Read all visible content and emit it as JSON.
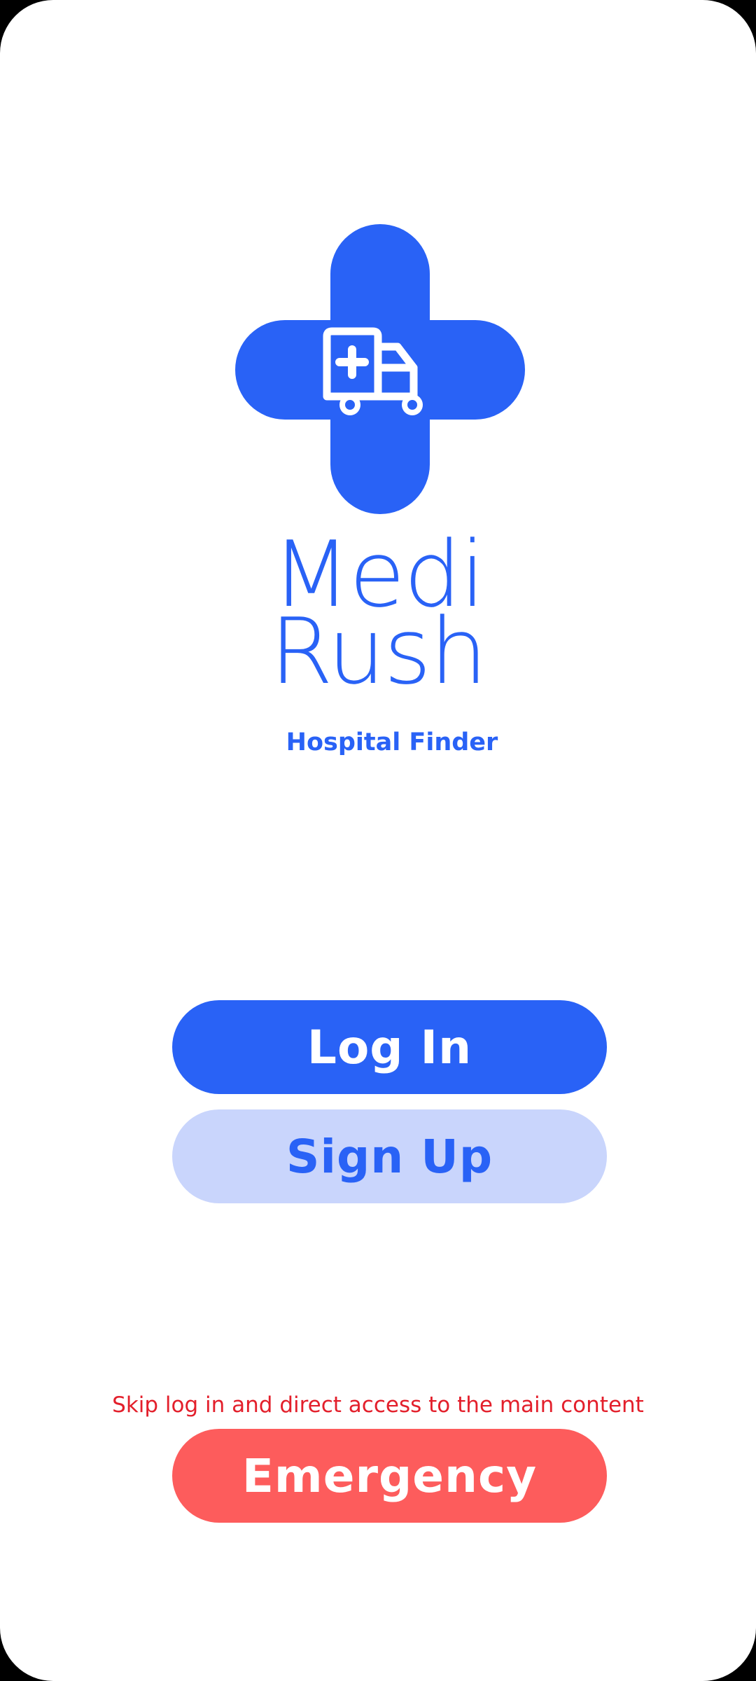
{
  "app": {
    "name_line1": "Medi",
    "name_line2": "Rush",
    "tagline": "Hospital Finder"
  },
  "logo": {
    "icon": "ambulance-icon",
    "shape": "plus-cross"
  },
  "actions": {
    "login_label": "Log In",
    "signup_label": "Sign Up",
    "skip_note": "Skip log in and direct access to the main content",
    "emergency_label": "Emergency"
  },
  "colors": {
    "brand_blue": "#2962f6",
    "light_blue": "#c9d5fc",
    "emergency_red": "#fd5c5c",
    "note_red": "#e31f2b",
    "background": "#ffffff"
  }
}
